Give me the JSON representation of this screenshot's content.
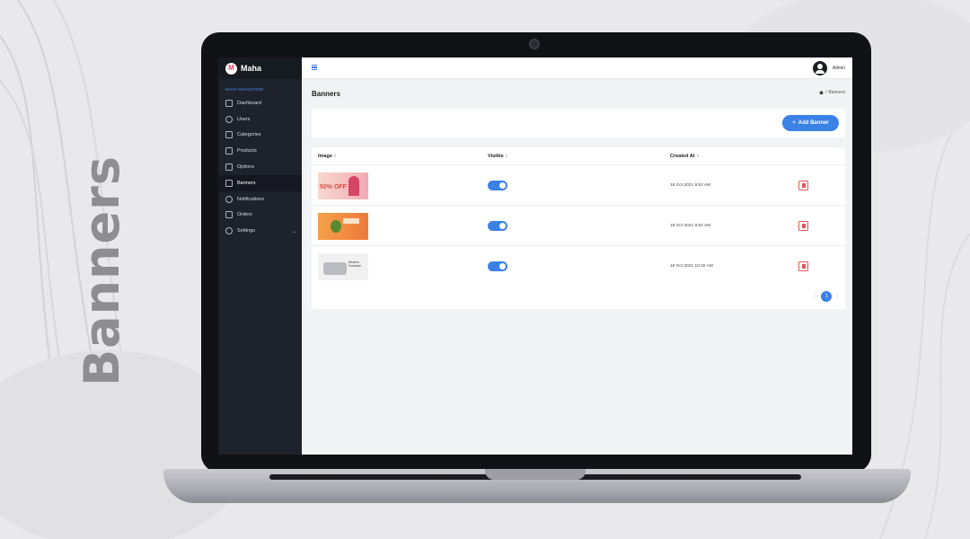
{
  "side_title": "Banners",
  "brand": {
    "name": "Maha",
    "logo_glyph": "M"
  },
  "sidebar": {
    "section": "MAIN NAVIGATION",
    "items": [
      {
        "label": "Dashboard",
        "icon": "home-icon"
      },
      {
        "label": "Users",
        "icon": "users-icon"
      },
      {
        "label": "Categories",
        "icon": "categories-icon"
      },
      {
        "label": "Products",
        "icon": "products-icon"
      },
      {
        "label": "Options",
        "icon": "options-icon"
      },
      {
        "label": "Banners",
        "icon": "banners-icon",
        "active": true
      },
      {
        "label": "Notifications",
        "icon": "bell-icon"
      },
      {
        "label": "Orders",
        "icon": "orders-icon"
      },
      {
        "label": "Settings",
        "icon": "gear-icon",
        "chevron": "⌄"
      }
    ]
  },
  "topbar": {
    "user": "Admin"
  },
  "page": {
    "title": "Banners",
    "breadcrumb_sep": "/",
    "breadcrumb": "Banners"
  },
  "toolbar": {
    "add_label": "Add Banner",
    "add_icon": "+"
  },
  "table": {
    "headers": {
      "image": "Image",
      "visible": "Visible",
      "created": "Created At",
      "sort": "⇕"
    },
    "rows": [
      {
        "image_text": "50% OFF",
        "visible": true,
        "created": "18 Oct 2021 9:52 AM"
      },
      {
        "image_text": "",
        "visible": true,
        "created": "18 Oct 2021 9:52 AM"
      },
      {
        "image_text": "Modern Furniture",
        "visible": true,
        "created": "18 Oct 2021 10:20 AM"
      }
    ]
  },
  "pagination": {
    "prev": "‹",
    "current": "1",
    "next": "›"
  },
  "colors": {
    "accent": "#3b82e6",
    "sidebar": "#1e222b",
    "danger": "#e25555"
  }
}
